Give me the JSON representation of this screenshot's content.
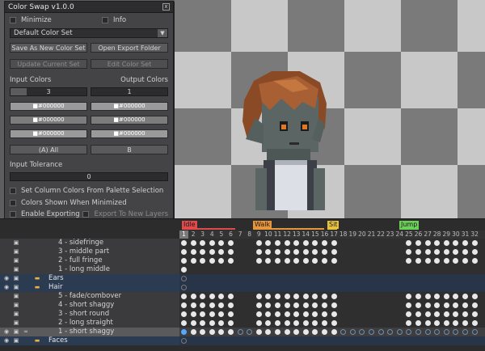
{
  "panel": {
    "title": "Color Swap v1.0.0",
    "close_label": "x",
    "minimize_label": "Minimize",
    "info_label": "Info",
    "color_set": "Default Color Set",
    "dropdown_arrow": "▼",
    "save_as_new_label": "Save As New Color Set",
    "open_export_label": "Open Export Folder",
    "update_current_label": "Update Current Set",
    "edit_color_set_label": "Edit Color Set",
    "input_colors_label": "Input Colors",
    "output_colors_label": "Output Colors",
    "input_colors_value": "3",
    "output_colors_value": "1",
    "input_swatches": [
      "#939393",
      "#B7B7B7",
      "#939393"
    ],
    "output_swatches": [
      "#939393",
      "#B7B7B7",
      "#939393"
    ],
    "swatch_hex_label": "■#000000",
    "input_mode_label": "(A) All",
    "output_mode_label": "B",
    "input_tolerance_label": "Input Tolerance",
    "input_tolerance_value": "0",
    "set_column_label": "Set Column Colors From Palette Selection",
    "colors_shown_label": "Colors Shown When Minimized",
    "enable_exporting_label": "Enable Exporting",
    "export_new_layers_label": "Export To New Layers"
  },
  "timeline": {
    "tags": [
      {
        "label": "Idle",
        "color": "#e04a4a"
      },
      {
        "label": "Walk",
        "color": "#e8963c"
      },
      {
        "label": "Sit",
        "color": "#e8c23c"
      },
      {
        "label": "Jump",
        "color": "#6ccf5a"
      }
    ],
    "frame_numbers": [
      "1",
      "2",
      "3",
      "4",
      "5",
      "6",
      "7",
      "8",
      "9",
      "10",
      "11",
      "12",
      "13",
      "14",
      "15",
      "16",
      "17",
      "18",
      "19",
      "20",
      "21",
      "22",
      "23",
      "24",
      "25",
      "26",
      "27",
      "28",
      "29",
      "30",
      "31",
      "32"
    ],
    "layers": [
      {
        "name": "4 - sidefringe"
      },
      {
        "name": "3 - middle part"
      },
      {
        "name": "2 - full fringe"
      },
      {
        "name": "1 - long middle"
      },
      {
        "name": "Ears"
      },
      {
        "name": "Hair"
      },
      {
        "name": "5 - fade/combover"
      },
      {
        "name": "4 - short shaggy"
      },
      {
        "name": "3 - short round"
      },
      {
        "name": "2 - long straight"
      },
      {
        "name": "1 - short shaggy"
      },
      {
        "name": "Faces"
      }
    ]
  },
  "icons": {
    "eye": "◉",
    "lock": "▣",
    "link": "∞",
    "folder": "▬"
  }
}
